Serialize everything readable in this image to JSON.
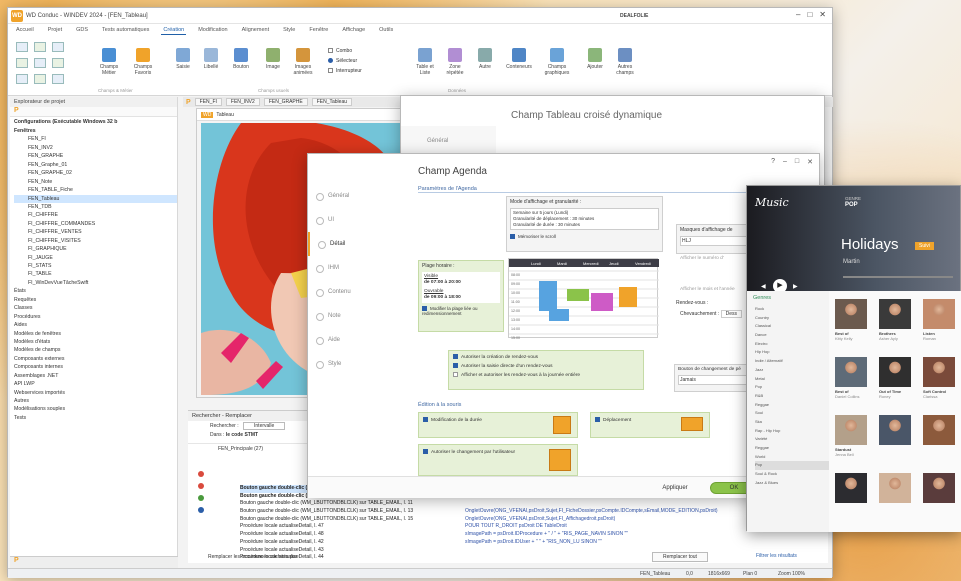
{
  "main": {
    "app_label": "WD",
    "title": "WD Conduc - WINDEV 2024 - [FEN_Tableau]",
    "brand": "DEALFOLIE"
  },
  "ribbon": {
    "tabs": [
      "Accueil",
      "Projet",
      "GDS",
      "Tests automatiques",
      "Création",
      "Modification",
      "Alignement",
      "Style",
      "Fenêtre",
      "Affichage",
      "Outils"
    ],
    "buttons": [
      "Champs Métier",
      "Champs Favoris",
      "Saisie",
      "Libellé",
      "Bouton",
      "Image",
      "Images animées",
      "Table et Liste",
      "Zone répétée",
      "Autre",
      "Conteneurs",
      "Champs graphiques",
      "Ajouter",
      "Autres champs"
    ],
    "options": [
      "Combo",
      "Sélecteur",
      "Interrupteur"
    ],
    "groups": [
      "Champs & Métier",
      "Champs usuels",
      "Données"
    ]
  },
  "doc_tabs": [
    "FEN_FI",
    "FEN_INV2",
    "FEN_GRAPHE",
    "FEN_Tableau"
  ],
  "explorer": {
    "title": "Explorateur de projet",
    "config": "Configurations (Exécutable Windows 32 b",
    "items": [
      {
        "label": "Fenêtres",
        "bold": true
      },
      {
        "label": "FEN_FI"
      },
      {
        "label": "FEN_INV2"
      },
      {
        "label": "FEN_GRAPHE"
      },
      {
        "label": "FEN_Graphe_01"
      },
      {
        "label": "FEN_GRAPHE_02"
      },
      {
        "label": "FEN_Note"
      },
      {
        "label": "FEN_TABLE_Fiche"
      },
      {
        "label": "FEN_Tableau",
        "sel": true
      },
      {
        "label": "FEN_TDB"
      },
      {
        "label": "FI_CHIFFRE"
      },
      {
        "label": "FI_CHIFFRE_COMMANDES"
      },
      {
        "label": "FI_CHIFFRE_VENTES"
      },
      {
        "label": "FI_CHIFFRE_VISITES"
      },
      {
        "label": "FI_GRAPHIQUE"
      },
      {
        "label": "FI_JAUGE"
      },
      {
        "label": "FI_STATS"
      },
      {
        "label": "FI_TABLE"
      },
      {
        "label": "FI_WinDevVueTâcheSwift"
      },
      {
        "label": "États"
      },
      {
        "label": "Requêtes"
      },
      {
        "label": "Classes"
      },
      {
        "label": "Procédures"
      },
      {
        "label": "Aides"
      },
      {
        "label": "Modèles de fenêtres"
      },
      {
        "label": "Modèles d'états"
      },
      {
        "label": "Modèles de champs"
      },
      {
        "label": "Composants externes"
      },
      {
        "label": "Composants internes"
      },
      {
        "label": "Assemblages .NET"
      },
      {
        "label": "API LWP"
      },
      {
        "label": "Webservices importés"
      },
      {
        "label": "Autres"
      },
      {
        "label": "Modélisations souples"
      },
      {
        "label": "Tests"
      }
    ]
  },
  "editor": {
    "window_title": "Tableau"
  },
  "find": {
    "title": "Rechercher - Remplacer",
    "search_label": "Rechercher :",
    "search_value": "Intervalle",
    "scope_label": "Dans :",
    "scope_value": "le code STMT",
    "replace_label": "Remplacer tout",
    "filter": "Filtrer les résultats",
    "tree_root": "FEN_Principale (27)",
    "lines_left": [
      "Bouton gauche double-clic (WM_LBUTTONDBLCLK) sur TABLE_EMAIL, l. 9",
      "Bouton gauche double-clic (WM_LBUTTONDBLCLK) sur TABLE_EMAIL, l. 10",
      "Bouton gauche double-clic (WM_LBUTTONDBLCLK) sur TABLE_EMAIL, l. 11",
      "Bouton gauche double-clic (WM_LBUTTONDBLCLK) sur TABLE_EMAIL, l. 13",
      "Bouton gauche double-clic (WM_LBUTTONDBLCLK) sur TABLE_EMAIL, l. 15",
      "Procédure locale actualiseDetail, l. 47",
      "Procédure locale actualiseDetail, l. 48",
      "Procédure locale actualiseDetail, l. 42",
      "Procédure locale actualiseDetail, l. 43",
      "Procédure locale actualiseDetail, l. 44"
    ],
    "lines_right": [
      "OngletOuvre(ONG_VFENAI,psDroit,Sujet,FI_FicheDossier,psCompte.IDCompte,sEmail,MODE_EDITION,psDroit)",
      "OngletOuvre(ONG_VFENAI,psDroit,Sujet,FI_Affichagedroit,psDroit)",
      "POUR TOUT R_DROIT psDroit DE TableDroit",
      "sImagePath = psDroit.IDProcedure + \" / \" + \"RIS_PAGE_NAVIN SINON \"\"",
      "sImagePath = psDroit.IDUser + \" \" + \"RIS_NON_LU SINON \"\""
    ],
    "footer": "Remplacer les occurrences cochées par :"
  },
  "status": {
    "left": "FEN_Tableau",
    "pos": "0,0",
    "size": "1816x669",
    "plan": "Plan 0",
    "zoom": "Zoom 100%"
  },
  "ctcd": {
    "title": "Champ Tableau croisé dynamique",
    "tab_general": "Général"
  },
  "agenda": {
    "title": "Champ Agenda",
    "param_section": "Paramètres de l'Agenda",
    "sidebar": [
      "Général",
      "UI",
      "Détail",
      "IHM",
      "Contenu",
      "Note",
      "Aide",
      "Style"
    ],
    "display_mode_title": "Mode d'affichage et granularité :",
    "display_mode": [
      "Semaine sur 5 jours (Lundi)",
      "Granularité de déplacement : 30 minutes",
      "Granularité de durée : 30 minutes"
    ],
    "mem_scroll": "Mémoriser le scroll",
    "time_range_title": "Plage horaire :",
    "visible": "Visible",
    "visible_range": "de 07:00 à 20:00",
    "working": "Ouvrable",
    "working_range": "de 09:00 à 18:00",
    "modify_hint": "Modifier la plage liée ou redimensionnement",
    "masks_title": "Masques d'affichage de",
    "mask_value": "HLJ",
    "show_week": "Afficher le numéro d'",
    "show_month": "Afficher le mois et l'année",
    "overlap_title": "Rendez-vous :",
    "overlap_label": "Chevauchement :",
    "overlap_value": "Dess",
    "create_rdv": "Autoriser la création de rendez-vous",
    "direct_entry": "Autoriser la saisie directe d'un rendez-vous",
    "day_view": "Afficher et autoriser les rendez-vous à la journée entière",
    "change_label": "Bouton de changement de pé",
    "change_value": "Jamais",
    "edit_section": "Édition à la souris",
    "edit_mod": "Modification de la durée",
    "edit_move": "Déplacement",
    "edit_change": "Autoriser le changement par l'utilisateur",
    "ok": "OK",
    "apply": "Appliquer",
    "help": "?",
    "cal_days": [
      "Lundi",
      "Mardi",
      "Mercredi",
      "Jeudi",
      "Vendredi"
    ],
    "cal_hours": [
      "08:00",
      "09:00",
      "10:00",
      "11:00",
      "12:00",
      "13:00",
      "14:00",
      "15:00"
    ]
  },
  "music": {
    "logo": "Music",
    "genre_label": "GENRE",
    "genre": "POP",
    "hero_title": "Holidays",
    "hero_btn": "Suivi",
    "artist": "Martin",
    "genres_title": "Genres",
    "genres": [
      "Rock",
      "Country",
      "Classical",
      "Dance",
      "Electro",
      "Hip Hop",
      "Indie / Alternatif",
      "Jazz",
      "Metal",
      "Pop",
      "R&B",
      "Reggae",
      "Soul",
      "Ska",
      "Rap - Hip Hop",
      "Variété",
      "Reggae",
      "World",
      "Pop",
      "Soul & Rock",
      "Jazz & Blues"
    ],
    "cards": [
      {
        "title": "Best of",
        "sub": "Kitty Kelly"
      },
      {
        "title": "Brothers",
        "sub": "Asher Ayly"
      },
      {
        "title": "Listen",
        "sub": "Roman"
      },
      {
        "title": "Best of",
        "sub": "Daniel Collins"
      },
      {
        "title": "Out of Time",
        "sub": "Roney"
      },
      {
        "title": "Soft Control",
        "sub": "Clarissa"
      },
      {
        "title": "Stardust",
        "sub": "Jenna Bell"
      }
    ]
  },
  "colors": {
    "accent": "#f0a32a",
    "blue": "#2b5ea8",
    "green": "#c5dba6"
  }
}
